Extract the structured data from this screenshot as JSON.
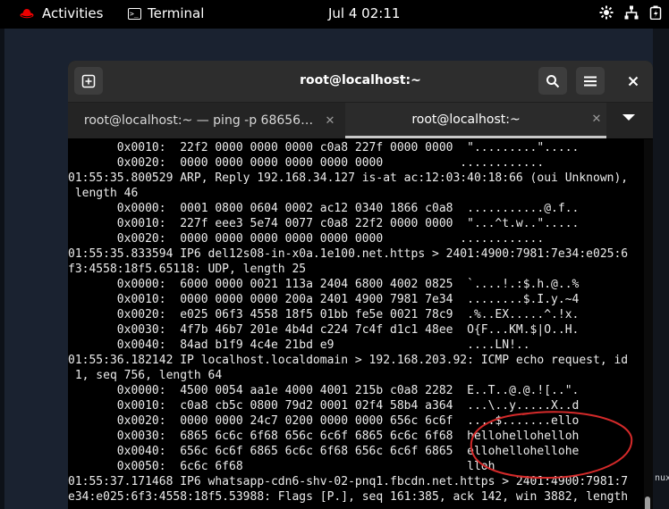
{
  "topbar": {
    "activities": "Activities",
    "app_name": "Terminal",
    "clock": "Jul 4  02:11",
    "tray_icons": [
      "accessibility-icon",
      "network-icon",
      "power-icon"
    ]
  },
  "window": {
    "title": "root@localhost:~",
    "new_tab_label": "⊞",
    "search_label": "⌕",
    "menu_label": "☰",
    "close_label": "✕"
  },
  "tabs": [
    {
      "label": "root@localhost:~ — ping -p 68656…",
      "close": "✕"
    },
    {
      "label": "root@localhost:~",
      "close": "✕"
    }
  ],
  "terminal": {
    "lines": [
      "       0x0010:  22f2 0000 0000 0000 c0a8 227f 0000 0000  \".........\".....",
      "       0x0020:  0000 0000 0000 0000 0000 0000           ............",
      "01:55:35.800529 ARP, Reply 192.168.34.127 is-at ac:12:03:40:18:66 (oui Unknown),",
      " length 46",
      "       0x0000:  0001 0800 0604 0002 ac12 0340 1866 c0a8  ...........@.f..",
      "       0x0010:  227f eee3 5e74 0077 c0a8 22f2 0000 0000  \"...^t.w..\".....",
      "       0x0020:  0000 0000 0000 0000 0000 0000           ............",
      "01:55:35.833594 IP6 del12s08-in-x0a.1e100.net.https > 2401:4900:7981:7e34:e025:6",
      "f3:4558:18f5.65118: UDP, length 25",
      "       0x0000:  6000 0000 0021 113a 2404 6800 4002 0825  `....!.:$.h.@..%",
      "       0x0010:  0000 0000 0000 200a 2401 4900 7981 7e34  ........$.I.y.~4",
      "       0x0020:  e025 06f3 4558 18f5 01bb fe5e 0021 78c9  .%..EX.....^.!x.",
      "       0x0030:  4f7b 46b7 201e 4b4d c224 7c4f d1c1 48ee  O{F...KM.$|O..H.",
      "       0x0040:  84ad b1f9 4c4e 21bd e9                   ....LN!..",
      "01:55:36.182142 IP localhost.localdomain > 192.168.203.92: ICMP echo request, id",
      " 1, seq 756, length 64",
      "       0x0000:  4500 0054 aa1e 4000 4001 215b c0a8 2282  E..T..@.@.![..\".",
      "       0x0010:  c0a8 cb5c 0800 79d2 0001 02f4 58b4 a364  ...\\..y.....X..d",
      "       0x0020:  0000 0000 24c7 0200 0000 0000 656c 6c6f  ....$.......ello",
      "       0x0030:  6865 6c6c 6f68 656c 6c6f 6865 6c6c 6f68  hellohellohelloh",
      "       0x0040:  656c 6c6f 6865 6c6c 6f68 656c 6c6f 6865  ellohellohellohe",
      "       0x0050:  6c6c 6f68                                lloh",
      "01:55:37.171468 IP6 whatsapp-cdn6-shv-02-pnq1.fbcdn.net.https > 2401:4900:7981:7",
      "e34:e025:6f3:4558:18f5.53988: Flags [P.], seq 161:385, ack 142, win 3882, length"
    ]
  },
  "desktop": {
    "partial_text": "nux"
  },
  "annotation_color": "#d42a2a"
}
